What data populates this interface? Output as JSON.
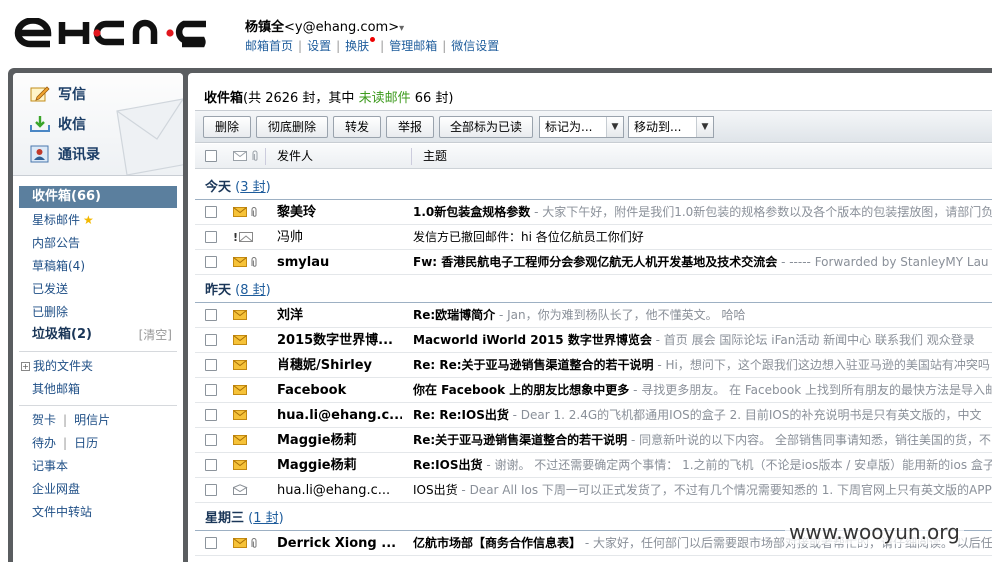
{
  "user": {
    "name": "杨镇全",
    "email": "<y@ehang.com>",
    "caret": "▾"
  },
  "top_links": [
    "邮箱首页",
    "设置",
    "换肤",
    "管理邮箱",
    "微信设置"
  ],
  "compose": {
    "write": "写信",
    "receive": "收信",
    "contacts": "通讯录"
  },
  "folders": [
    {
      "label": "收件箱(66)",
      "active": true
    },
    {
      "label": "星标邮件"
    },
    {
      "label": "内部公告"
    },
    {
      "label": "草稿箱(4)"
    },
    {
      "label": "已发送"
    },
    {
      "label": "已删除"
    },
    {
      "label": "垃圾箱(2)",
      "bold": true,
      "action": "[清空]"
    }
  ],
  "my_folders": {
    "expand": "+",
    "label": "我的文件夹",
    "other": "其他邮箱"
  },
  "apps": {
    "card": "贺卡",
    "postcard": "明信片",
    "todo": "待办",
    "calendar": "日历",
    "notebook": "记事本",
    "netdisk": "企业网盘",
    "transfer": "文件中转站"
  },
  "inbox": {
    "title": "收件箱",
    "summary_prefix": "(共 2626 封，其中 ",
    "unread_label": "未读邮件",
    "summary_suffix": " 66 封)"
  },
  "toolbar": {
    "delete": "删除",
    "purge": "彻底删除",
    "forward": "转发",
    "report": "举报",
    "mark_all_read": "全部标为已读",
    "mark_as": "标记为...",
    "move_to": "移动到...",
    "arrow": "▼"
  },
  "columns": {
    "from": "发件人",
    "subject": "主题"
  },
  "groups": [
    {
      "label": "今天",
      "count_prefix": " (",
      "count": "3 封",
      "count_suffix": ")"
    },
    {
      "label": "昨天",
      "count_prefix": " (",
      "count": "8 封",
      "count_suffix": ")"
    },
    {
      "label": "星期三",
      "count_prefix": " (",
      "count": "1 封",
      "count_suffix": ")"
    }
  ],
  "rows": [
    {
      "from": "黎美玲",
      "subject": "1.0新包装盒规格参数",
      "preview": " - 大家下午好，附件是我们1.0新包装的规格参数以及各个版本的包装摆放图，请部门负",
      "unread": true,
      "attach": true
    },
    {
      "from": "冯帅",
      "subject": "发信方已撤回邮件：hi 各位亿航员工你们好",
      "preview": "",
      "unread": false,
      "attach": false,
      "flag": "!"
    },
    {
      "from": "smylau",
      "subject": "Fw: 香港民航电子工程师分会参观亿航无人机开发基地及技术交流会",
      "preview": " - ----- Forwarded by StanleyMY Lau",
      "unread": true,
      "attach": true
    },
    {
      "from": "刘洋",
      "subject": "Re:欧瑞博简介",
      "preview": " - Jan，你为难到杨队长了，他不懂英文。 哈哈",
      "unread": true,
      "attach": false
    },
    {
      "from": "2015数字世界博...",
      "subject": "Macworld iWorld 2015 数字世界博览会",
      "preview": " - 首页 展会 国际论坛 iFan活动 新闻中心 联系我们 观众登录",
      "unread": true,
      "attach": false
    },
    {
      "from": "肖穗妮/Shirley",
      "subject": "Re: Re:关于亚马逊销售渠道整合的若干说明",
      "preview": " - Hi，想问下，这个跟我们这边想入驻亚马逊的美国站有冲突吗",
      "unread": true,
      "attach": false
    },
    {
      "from": "Facebook",
      "subject": "你在 Facebook 上的朋友比想象中更多",
      "preview": " - 寻找更多朋友。 在 Facebook 上找到所有朋友的最快方法是导入邮",
      "unread": true,
      "attach": false
    },
    {
      "from": "hua.li@ehang.c...",
      "subject": "Re: Re:IOS出货",
      "preview": " - Dear 1. 2.4G的飞机都通用IOS的盒子 2. 目前IOS的补充说明书是只有英文版的，中文",
      "unread": true,
      "attach": false
    },
    {
      "from": "Maggie杨莉",
      "subject": "Re:关于亚马逊销售渠道整合的若干说明",
      "preview": " - 同意新叶说的以下内容。 全部销售同事请知悉，销往美国的货，不",
      "unread": true,
      "attach": false
    },
    {
      "from": "Maggie杨莉",
      "subject": "Re:IOS出货",
      "preview": " - 谢谢。 不过还需要确定两个事情： 1.之前的飞机（不论是ios版本 / 安卓版）能用新的ios 盒子",
      "unread": true,
      "attach": false
    },
    {
      "from": "hua.li@ehang.c...",
      "subject": "IOS出货",
      "preview": " - Dear All Ios 下周一可以正式发货了，不过有几个情况需要知悉的 1. 下周官网上只有英文版的APP",
      "unread": false,
      "attach": false
    },
    {
      "from": "Derrick Xiong ...",
      "subject": "亿航市场部【商务合作信息表】",
      "preview": " - 大家好，任何部门以后需要跟市场部对接或者帮忙的，请仔细阅读。 以后任",
      "unread": true,
      "attach": true
    }
  ],
  "watermark": "www.wooyun.org"
}
